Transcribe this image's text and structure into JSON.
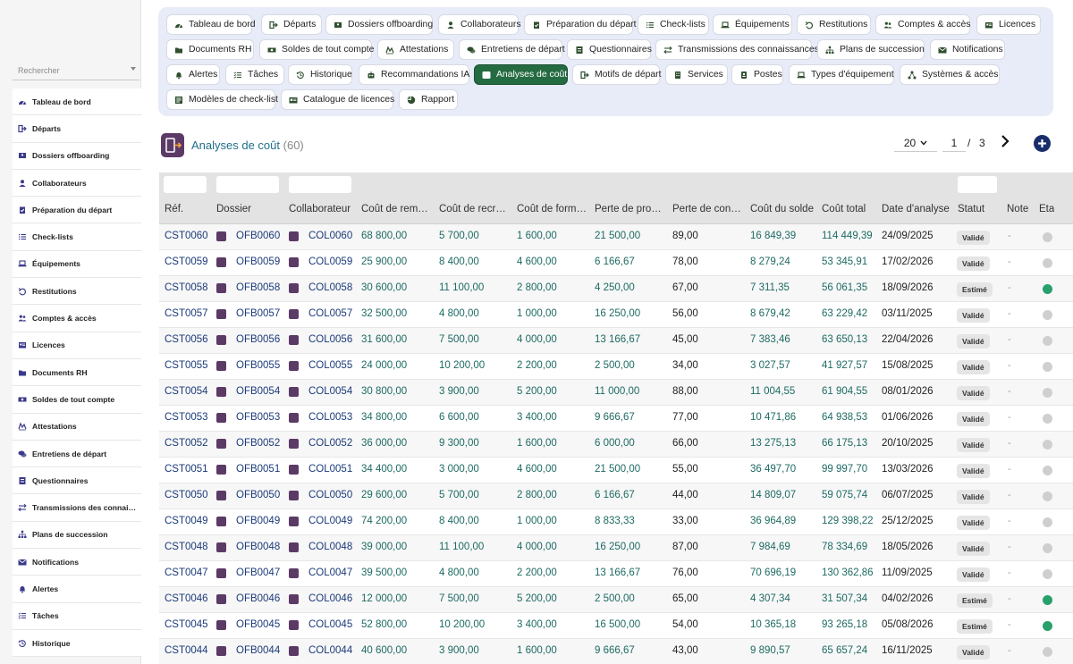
{
  "sidebar": {
    "search_placeholder": "Rechercher",
    "items": [
      {
        "label": "Tableau de bord",
        "icon": "dashboard-icon"
      },
      {
        "label": "Départs",
        "icon": "exit-icon"
      },
      {
        "label": "Dossiers offboarding",
        "icon": "folder-user-icon"
      },
      {
        "label": "Collaborateurs",
        "icon": "user-icon"
      },
      {
        "label": "Préparation du départ",
        "icon": "clipboard-check-icon"
      },
      {
        "label": "Check-lists",
        "icon": "checklist-icon"
      },
      {
        "label": "Équipements",
        "icon": "laptop-icon"
      },
      {
        "label": "Restitutions",
        "icon": "undo-icon"
      },
      {
        "label": "Comptes & accès",
        "icon": "users-icon"
      },
      {
        "label": "Licences",
        "icon": "license-icon"
      },
      {
        "label": "Documents RH",
        "icon": "folder-icon"
      },
      {
        "label": "Soldes de tout compte",
        "icon": "money-icon"
      },
      {
        "label": "Attestations",
        "icon": "signature-icon"
      },
      {
        "label": "Entretiens de départ",
        "icon": "chat-icon"
      },
      {
        "label": "Questionnaires",
        "icon": "form-icon"
      },
      {
        "label": "Transmissions des connaiss…",
        "icon": "transfer-icon"
      },
      {
        "label": "Plans de succession",
        "icon": "sitemap-icon"
      },
      {
        "label": "Notifications",
        "icon": "envelope-icon"
      },
      {
        "label": "Alertes",
        "icon": "bell-icon"
      },
      {
        "label": "Tâches",
        "icon": "tasks-icon"
      },
      {
        "label": "Historique",
        "icon": "history-icon"
      }
    ]
  },
  "nav": {
    "items": [
      {
        "label": "Tableau de bord",
        "icon": "dashboard-icon"
      },
      {
        "label": "Départs",
        "icon": "exit-icon"
      },
      {
        "label": "Dossiers offboarding",
        "icon": "folder-user-icon"
      },
      {
        "label": "Collaborateurs",
        "icon": "user-icon"
      },
      {
        "label": "Préparation du départ",
        "icon": "clipboard-check-icon"
      },
      {
        "label": "Check-lists",
        "icon": "checklist-icon"
      },
      {
        "label": "Équipements",
        "icon": "laptop-icon"
      },
      {
        "label": "Restitutions",
        "icon": "undo-icon"
      },
      {
        "label": "Comptes & accès",
        "icon": "users-icon"
      },
      {
        "label": "Licences",
        "icon": "license-icon"
      },
      {
        "label": "Documents RH",
        "icon": "folder-icon"
      },
      {
        "label": "Soldes de tout compte",
        "icon": "money-icon"
      },
      {
        "label": "Attestations",
        "icon": "signature-icon"
      },
      {
        "label": "Entretiens de départ",
        "icon": "chat-icon"
      },
      {
        "label": "Questionnaires",
        "icon": "form-icon"
      },
      {
        "label": "Transmissions des connaissances",
        "icon": "transfer-icon"
      },
      {
        "label": "Plans de succession",
        "icon": "sitemap-icon"
      },
      {
        "label": "Notifications",
        "icon": "envelope-icon"
      },
      {
        "label": "Alertes",
        "icon": "bell-icon"
      },
      {
        "label": "Tâches",
        "icon": "tasks-icon"
      },
      {
        "label": "Historique",
        "icon": "history-icon"
      },
      {
        "label": "Recommandations IA",
        "icon": "robot-icon"
      },
      {
        "label": "Analyses de coût",
        "icon": "cost-icon",
        "active": true
      },
      {
        "label": "Motifs de départ",
        "icon": "exit-icon"
      },
      {
        "label": "Services",
        "icon": "building-icon"
      },
      {
        "label": "Postes",
        "icon": "badge-icon"
      },
      {
        "label": "Types d'équipement",
        "icon": "laptop-icon"
      },
      {
        "label": "Systèmes & accès",
        "icon": "network-icon"
      },
      {
        "label": "Modèles de check-list",
        "icon": "template-icon"
      },
      {
        "label": "Catalogue de licences",
        "icon": "catalog-icon"
      },
      {
        "label": "Rapport",
        "icon": "pie-chart-icon"
      }
    ]
  },
  "header": {
    "title": "Analyses de coût",
    "count": "(60)",
    "page_size": "20",
    "page": "1",
    "page_sep": "/",
    "page_total": "3"
  },
  "table": {
    "columns": [
      "Réf.",
      "Dossier",
      "Collaborateur",
      "Coût de remplacement",
      "Coût de recrutement",
      "Coût de formation",
      "Perte de productivité",
      "Perte de connaissances",
      "Coût du solde",
      "Coût total",
      "Date d'analyse",
      "Statut",
      "Note",
      "État"
    ],
    "columns_display": [
      "Réf.",
      "Dossier",
      "Collaborateur",
      "Coût de rem…",
      "Coût de recr…",
      "Coût de form…",
      "Perte de pro…",
      "Perte de con…",
      "Coût du solde",
      "Coût total",
      "Date d'analyse",
      "Statut",
      "Note",
      "Éta"
    ],
    "rows": [
      {
        "ref": "CST0060",
        "dossier": "OFB0060",
        "collab": "COL0060",
        "rem": "68 800,00",
        "recr": "5 700,00",
        "form": "1 600,00",
        "prod": "21 500,00",
        "conn": "89,00",
        "solde": "16 849,39",
        "total": "114 449,39",
        "date": "24/09/2025",
        "statut": "Validé",
        "note": "-",
        "etat": false
      },
      {
        "ref": "CST0059",
        "dossier": "OFB0059",
        "collab": "COL0059",
        "rem": "25 900,00",
        "recr": "8 400,00",
        "form": "4 600,00",
        "prod": "6 166,67",
        "conn": "78,00",
        "solde": "8 279,24",
        "total": "53 345,91",
        "date": "17/02/2026",
        "statut": "Validé",
        "note": "-",
        "etat": false
      },
      {
        "ref": "CST0058",
        "dossier": "OFB0058",
        "collab": "COL0058",
        "rem": "30 600,00",
        "recr": "11 100,00",
        "form": "2 800,00",
        "prod": "4 250,00",
        "conn": "67,00",
        "solde": "7 311,35",
        "total": "56 061,35",
        "date": "18/09/2026",
        "statut": "Estimé",
        "note": "-",
        "etat": true
      },
      {
        "ref": "CST0057",
        "dossier": "OFB0057",
        "collab": "COL0057",
        "rem": "32 500,00",
        "recr": "4 800,00",
        "form": "1 000,00",
        "prod": "16 250,00",
        "conn": "56,00",
        "solde": "8 679,42",
        "total": "63 229,42",
        "date": "03/11/2025",
        "statut": "Validé",
        "note": "-",
        "etat": false
      },
      {
        "ref": "CST0056",
        "dossier": "OFB0056",
        "collab": "COL0056",
        "rem": "31 600,00",
        "recr": "7 500,00",
        "form": "4 000,00",
        "prod": "13 166,67",
        "conn": "45,00",
        "solde": "7 383,46",
        "total": "63 650,13",
        "date": "22/04/2026",
        "statut": "Validé",
        "note": "-",
        "etat": false
      },
      {
        "ref": "CST0055",
        "dossier": "OFB0055",
        "collab": "COL0055",
        "rem": "24 000,00",
        "recr": "10 200,00",
        "form": "2 200,00",
        "prod": "2 500,00",
        "conn": "34,00",
        "solde": "3 027,57",
        "total": "41 927,57",
        "date": "15/08/2025",
        "statut": "Validé",
        "note": "-",
        "etat": false
      },
      {
        "ref": "CST0054",
        "dossier": "OFB0054",
        "collab": "COL0054",
        "rem": "30 800,00",
        "recr": "3 900,00",
        "form": "5 200,00",
        "prod": "11 000,00",
        "conn": "88,00",
        "solde": "11 004,55",
        "total": "61 904,55",
        "date": "08/01/2026",
        "statut": "Validé",
        "note": "-",
        "etat": false
      },
      {
        "ref": "CST0053",
        "dossier": "OFB0053",
        "collab": "COL0053",
        "rem": "34 800,00",
        "recr": "6 600,00",
        "form": "3 400,00",
        "prod": "9 666,67",
        "conn": "77,00",
        "solde": "10 471,86",
        "total": "64 938,53",
        "date": "01/06/2026",
        "statut": "Validé",
        "note": "-",
        "etat": false
      },
      {
        "ref": "CST0052",
        "dossier": "OFB0052",
        "collab": "COL0052",
        "rem": "36 000,00",
        "recr": "9 300,00",
        "form": "1 600,00",
        "prod": "6 000,00",
        "conn": "66,00",
        "solde": "13 275,13",
        "total": "66 175,13",
        "date": "20/10/2025",
        "statut": "Validé",
        "note": "-",
        "etat": false
      },
      {
        "ref": "CST0051",
        "dossier": "OFB0051",
        "collab": "COL0051",
        "rem": "34 400,00",
        "recr": "3 000,00",
        "form": "4 600,00",
        "prod": "21 500,00",
        "conn": "55,00",
        "solde": "36 497,70",
        "total": "99 997,70",
        "date": "13/03/2026",
        "statut": "Validé",
        "note": "-",
        "etat": false
      },
      {
        "ref": "CST0050",
        "dossier": "OFB0050",
        "collab": "COL0050",
        "rem": "29 600,00",
        "recr": "5 700,00",
        "form": "2 800,00",
        "prod": "6 166,67",
        "conn": "44,00",
        "solde": "14 809,07",
        "total": "59 075,74",
        "date": "06/07/2025",
        "statut": "Validé",
        "note": "-",
        "etat": false
      },
      {
        "ref": "CST0049",
        "dossier": "OFB0049",
        "collab": "COL0049",
        "rem": "74 200,00",
        "recr": "8 400,00",
        "form": "1 000,00",
        "prod": "8 833,33",
        "conn": "33,00",
        "solde": "36 964,89",
        "total": "129 398,22",
        "date": "25/12/2025",
        "statut": "Validé",
        "note": "-",
        "etat": false
      },
      {
        "ref": "CST0048",
        "dossier": "OFB0048",
        "collab": "COL0048",
        "rem": "39 000,00",
        "recr": "11 100,00",
        "form": "4 000,00",
        "prod": "16 250,00",
        "conn": "87,00",
        "solde": "7 984,69",
        "total": "78 334,69",
        "date": "18/05/2026",
        "statut": "Validé",
        "note": "-",
        "etat": false
      },
      {
        "ref": "CST0047",
        "dossier": "OFB0047",
        "collab": "COL0047",
        "rem": "39 500,00",
        "recr": "4 800,00",
        "form": "2 200,00",
        "prod": "13 166,67",
        "conn": "76,00",
        "solde": "70 696,19",
        "total": "130 362,86",
        "date": "11/09/2025",
        "statut": "Validé",
        "note": "-",
        "etat": false
      },
      {
        "ref": "CST0046",
        "dossier": "OFB0046",
        "collab": "COL0046",
        "rem": "12 000,00",
        "recr": "7 500,00",
        "form": "5 200,00",
        "prod": "2 500,00",
        "conn": "65,00",
        "solde": "4 307,34",
        "total": "31 507,34",
        "date": "04/02/2026",
        "statut": "Estimé",
        "note": "-",
        "etat": true
      },
      {
        "ref": "CST0045",
        "dossier": "OFB0045",
        "collab": "COL0045",
        "rem": "52 800,00",
        "recr": "10 200,00",
        "form": "3 400,00",
        "prod": "16 500,00",
        "conn": "54,00",
        "solde": "10 365,18",
        "total": "93 265,18",
        "date": "05/08/2026",
        "statut": "Estimé",
        "note": "-",
        "etat": true
      },
      {
        "ref": "CST0044",
        "dossier": "OFB0044",
        "collab": "COL0044",
        "rem": "40 600,00",
        "recr": "3 900,00",
        "form": "1 600,00",
        "prod": "9 666,67",
        "conn": "43,00",
        "solde": "9 890,57",
        "total": "65 657,24",
        "date": "16/11/2025",
        "statut": "Validé",
        "note": "-",
        "etat": false
      }
    ]
  },
  "colors": {
    "active_chip": "#256b42",
    "link": "#1b3a7a",
    "value_green": "#1d6a63",
    "title": "#1f6f8b",
    "etat_on": "#27a06b",
    "add_button": "#1a2d6b"
  }
}
